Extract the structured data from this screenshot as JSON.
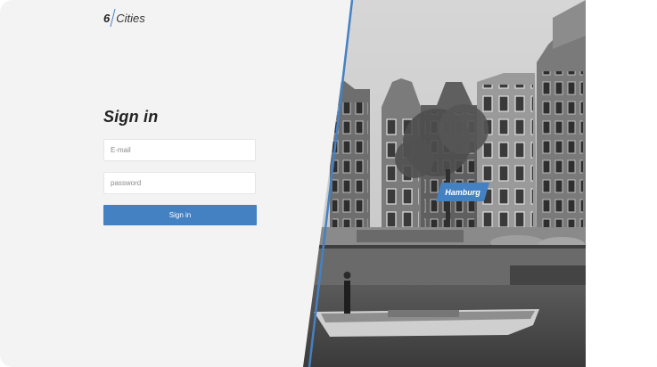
{
  "header": {
    "logo_number": "6",
    "logo_text": "Cities"
  },
  "login": {
    "title": "Sign in",
    "email_placeholder": "E-mail",
    "password_placeholder": "password",
    "submit_label": "Sign in"
  },
  "location": {
    "city": "Hamburg"
  },
  "colors": {
    "accent": "#4481c3",
    "background": "#f3f3f3"
  }
}
